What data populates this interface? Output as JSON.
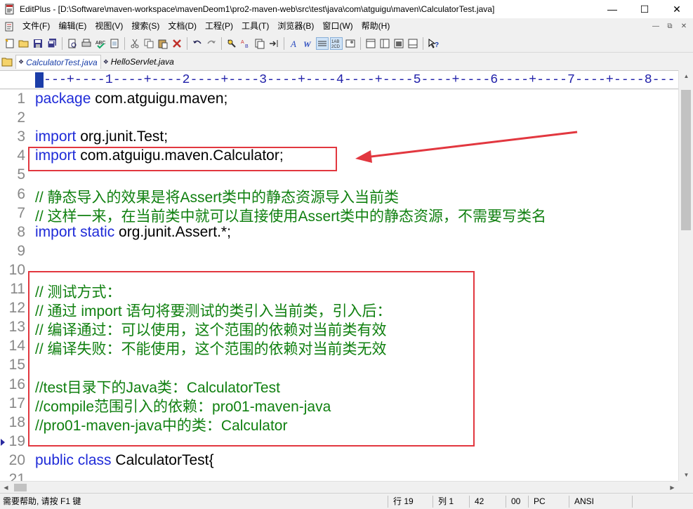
{
  "window": {
    "title": "EditPlus - [D:\\Software\\maven-workspace\\mavenDeom1\\pro2-maven-web\\src\\test\\java\\com\\atguigu\\maven\\CalculatorTest.java]",
    "minimize": "—",
    "maximize": "☐",
    "close": "✕"
  },
  "menu": {
    "items": [
      "文件(F)",
      "编辑(E)",
      "视图(V)",
      "搜索(S)",
      "文档(D)",
      "工程(P)",
      "工具(T)",
      "浏览器(B)",
      "窗口(W)",
      "帮助(H)"
    ],
    "mdi_min": "—",
    "mdi_restore": "⧉",
    "mdi_close": "✕"
  },
  "tabs": [
    {
      "label": "CalculatorTest.java",
      "active": true
    },
    {
      "label": "HelloServlet.java",
      "active": false
    }
  ],
  "ruler": {
    "text": "---+----1----+----2----+----3----+----4----+----5----+----6----+----7----+----8---"
  },
  "editor": {
    "lines": [
      {
        "n": "1",
        "parts": [
          {
            "t": "package",
            "c": "kw"
          },
          {
            "t": " com.atguigu.maven;",
            "c": "plain"
          }
        ]
      },
      {
        "n": "2",
        "parts": []
      },
      {
        "n": "3",
        "parts": [
          {
            "t": "import",
            "c": "kw"
          },
          {
            "t": " org.junit.Test;",
            "c": "plain"
          }
        ]
      },
      {
        "n": "4",
        "parts": [
          {
            "t": "import",
            "c": "kw"
          },
          {
            "t": " com.atguigu.maven.Calculator;",
            "c": "plain"
          }
        ]
      },
      {
        "n": "5",
        "parts": []
      },
      {
        "n": "6",
        "parts": [
          {
            "t": "// 静态导入的效果是将Assert类中的静态资源导入当前类",
            "c": "cmt"
          }
        ]
      },
      {
        "n": "7",
        "parts": [
          {
            "t": "// 这样一来，在当前类中就可以直接使用Assert类中的静态资源，不需要写类名",
            "c": "cmt"
          }
        ]
      },
      {
        "n": "8",
        "parts": [
          {
            "t": "import static",
            "c": "kw"
          },
          {
            "t": " org.junit.Assert.*;",
            "c": "plain"
          }
        ]
      },
      {
        "n": "9",
        "parts": []
      },
      {
        "n": "10",
        "parts": []
      },
      {
        "n": "11",
        "parts": [
          {
            "t": "//  测试方式：",
            "c": "cmt"
          }
        ]
      },
      {
        "n": "12",
        "parts": [
          {
            "t": "//  通过 import 语句将要测试的类引入当前类，引入后：",
            "c": "cmt"
          }
        ]
      },
      {
        "n": "13",
        "parts": [
          {
            "t": "//  编译通过：可以使用，这个范围的依赖对当前类有效",
            "c": "cmt"
          }
        ]
      },
      {
        "n": "14",
        "parts": [
          {
            "t": "//  编译失败：不能使用，这个范围的依赖对当前类无效",
            "c": "cmt"
          }
        ]
      },
      {
        "n": "15",
        "parts": []
      },
      {
        "n": "16",
        "parts": [
          {
            "t": "//test目录下的Java类：CalculatorTest",
            "c": "cmt"
          }
        ]
      },
      {
        "n": "17",
        "parts": [
          {
            "t": "//compile范围引入的依赖：pro01-maven-java",
            "c": "cmt"
          }
        ]
      },
      {
        "n": "18",
        "parts": [
          {
            "t": "//pro01-maven-java中的类：Calculator",
            "c": "cmt"
          }
        ]
      },
      {
        "n": "19",
        "parts": []
      },
      {
        "n": "20",
        "parts": [
          {
            "t": "public class",
            "c": "kw"
          },
          {
            "t": " CalculatorTest{",
            "c": "plain"
          }
        ]
      },
      {
        "n": "21",
        "parts": []
      }
    ],
    "current_line_marker": "19"
  },
  "status": {
    "help": "需要帮助, 请按 F1 键",
    "line": "行 19",
    "col": "列 1",
    "chars": "42",
    "mode": "00",
    "platform": "PC",
    "encoding": "ANSI"
  },
  "colors": {
    "keyword": "#1f2bd8",
    "comment": "#108010",
    "annotation": "#e2373f"
  }
}
